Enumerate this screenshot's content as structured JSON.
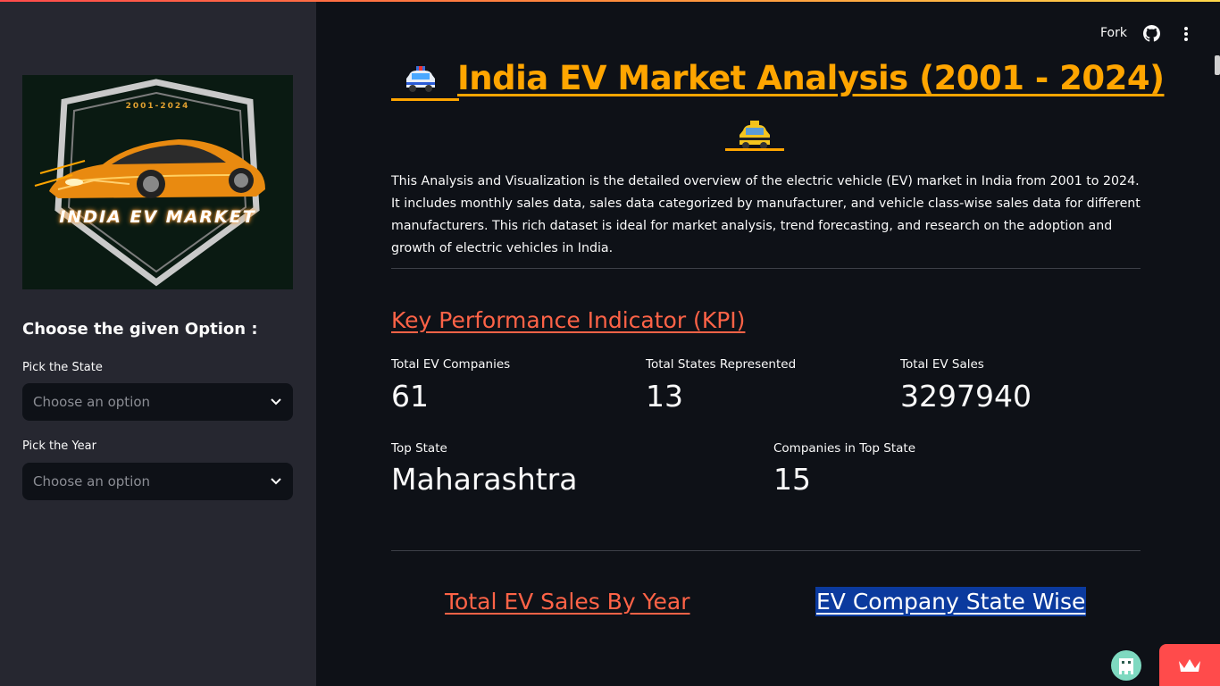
{
  "header": {
    "fork_label": "Fork",
    "github_icon": "github-icon",
    "menu_icon": "kebab-menu-icon"
  },
  "sidebar": {
    "logo": {
      "years": "2001-2024",
      "title": "INDIA EV MARKET"
    },
    "heading": "Choose the given Option :",
    "state_select": {
      "label": "Pick the State",
      "placeholder": "Choose an option"
    },
    "year_select": {
      "label": "Pick the Year",
      "placeholder": "Choose an option"
    }
  },
  "main": {
    "title": "India EV Market Analysis (2001 - 2024)",
    "title_icon": "taxi-icon",
    "description": "This Analysis and Visualization is the detailed overview of the electric vehicle (EV) market in India from 2001 to 2024. It includes monthly sales data, sales data categorized by manufacturer, and vehicle class-wise sales data for different manufacturers. This rich dataset is ideal for market analysis, trend forecasting, and research on the adoption and growth of electric vehicles in India.",
    "kpi_heading": "Key Performance Indicator (KPI)",
    "metrics": [
      {
        "label": "Total EV Companies",
        "value": "61"
      },
      {
        "label": "Total States Represented",
        "value": "13"
      },
      {
        "label": "Total EV Sales",
        "value": "3297940"
      },
      {
        "label": "Top State",
        "value": "Maharashtra"
      },
      {
        "label": "Companies in Top State",
        "value": "15"
      }
    ],
    "tabs": [
      {
        "label": "Total EV Sales By Year"
      },
      {
        "label": "EV Company State Wise"
      }
    ]
  },
  "colors": {
    "title_accent": "#ffa500",
    "kpi_accent": "#ff6347",
    "selected_tab_bg": "#0b3a9e",
    "sidebar_bg": "#262730",
    "main_bg": "#0e1117"
  }
}
